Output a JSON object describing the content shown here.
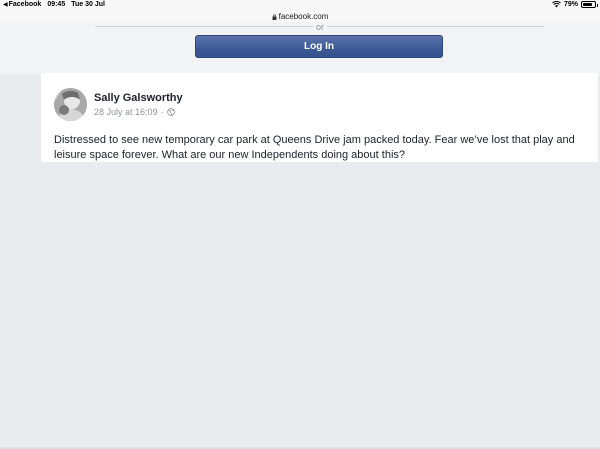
{
  "status_bar": {
    "back_app": "Facebook",
    "time": "09:45",
    "date": "Tue 30 Jul",
    "battery": "79%",
    "battery_level": 0.79
  },
  "url_bar": {
    "domain": "facebook.com"
  },
  "login": {
    "or_text": "or",
    "button_label": "Log In"
  },
  "post": {
    "author": "Sally Galsworthy",
    "timestamp": "28 July at 16:09",
    "separator": "·",
    "text": "Distressed to see new temporary car park at Queens Drive jam packed today. Fear we’ve lost that play and leisure space forever. What are our new Independents doing about this?"
  },
  "colors": {
    "page_bg": "#e9ebee",
    "button": "#4267b2",
    "text": "#1d2129",
    "muted": "#90949c"
  }
}
